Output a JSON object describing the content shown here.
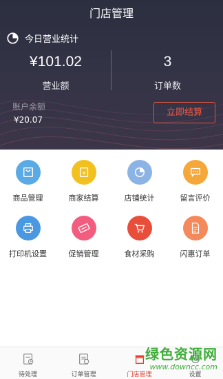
{
  "header": {
    "title": "门店管理",
    "stats_label": "今日营业统计",
    "revenue_value": "¥101.02",
    "revenue_label": "营业额",
    "orders_value": "3",
    "orders_label": "订单数",
    "balance_label": "账户余额",
    "balance_value": "¥20.07",
    "settle_button": "立即结算"
  },
  "grid": {
    "items": [
      {
        "label": "商品管理",
        "icon": "bag-icon",
        "color": "#5aaae6"
      },
      {
        "label": "商家结算",
        "icon": "yen-card-icon",
        "color": "#f3c11f"
      },
      {
        "label": "店铺统计",
        "icon": "pie-chart-icon",
        "color": "#8bb4e5"
      },
      {
        "label": "留言评价",
        "icon": "message-icon",
        "color": "#f6a73a"
      },
      {
        "label": "打印机设置",
        "icon": "printer-icon",
        "color": "#4a97e2"
      },
      {
        "label": "促销管理",
        "icon": "promo-tag-icon",
        "color": "#f25d7f"
      },
      {
        "label": "食材采购",
        "icon": "cart-icon",
        "color": "#e94e3b"
      },
      {
        "label": "闪惠订单",
        "icon": "document-icon",
        "color": "#f48a5c"
      }
    ]
  },
  "tabbar": {
    "tabs": [
      {
        "label": "待处理",
        "icon": "pending-icon"
      },
      {
        "label": "订单管理",
        "icon": "orders-icon"
      },
      {
        "label": "门店管理",
        "icon": "store-icon"
      },
      {
        "label": "设置",
        "icon": "settings-icon"
      }
    ],
    "active_color": "#e53c2c"
  },
  "watermark": {
    "title": "绿色资源网",
    "url": "www.downcc.com"
  }
}
